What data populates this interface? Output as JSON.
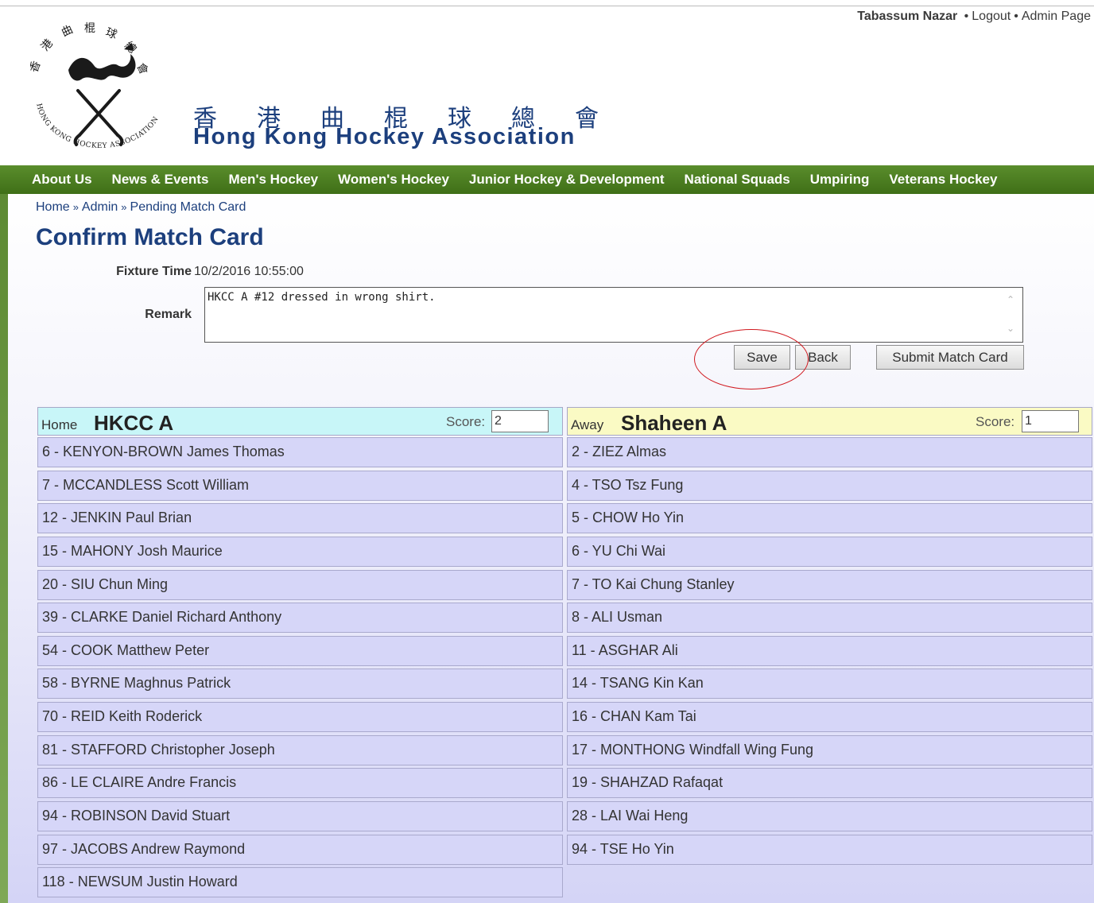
{
  "user_bar": {
    "user_name": "Tabassum Nazar",
    "separator": "•",
    "logout": "Logout",
    "admin_page": "Admin Page"
  },
  "header": {
    "title_cn": [
      "香",
      "港",
      "曲",
      "棍",
      "球",
      "總",
      "會"
    ],
    "title_en": "Hong Kong Hockey Association"
  },
  "nav": {
    "items": [
      "About Us",
      "News & Events",
      "Men's Hockey",
      "Women's Hockey",
      "Junior Hockey & Development",
      "National Squads",
      "Umpiring",
      "Veterans Hockey"
    ]
  },
  "breadcrumb": {
    "items": [
      "Home",
      "Admin",
      "Pending Match Card"
    ],
    "separator": "»"
  },
  "page_title": "Confirm Match Card",
  "form": {
    "fixture_time_label": "Fixture Time",
    "fixture_time_value": "10/2/2016 10:55:00",
    "remark_label": "Remark",
    "remark_value": "HKCC A #12 dressed in wrong shirt."
  },
  "buttons": {
    "save": "Save",
    "back": "Back",
    "submit": "Submit Match Card"
  },
  "home": {
    "side_label": "Home",
    "team_name": "HKCC A",
    "score_label": "Score:",
    "score": "2",
    "players": [
      "6 - KENYON-BROWN James Thomas",
      "7 - MCCANDLESS Scott William",
      "12 - JENKIN Paul Brian",
      "15 - MAHONY Josh Maurice",
      "20 - SIU Chun Ming",
      "39 - CLARKE Daniel Richard Anthony",
      "54 - COOK Matthew Peter",
      "58 - BYRNE Maghnus Patrick",
      "70 - REID Keith Roderick",
      "81 - STAFFORD Christopher Joseph",
      "86 - LE CLAIRE Andre Francis",
      "94 - ROBINSON David Stuart",
      "97 - JACOBS Andrew Raymond",
      "118 - NEWSUM Justin Howard"
    ]
  },
  "away": {
    "side_label": "Away",
    "team_name": "Shaheen A",
    "score_label": "Score:",
    "score": "1",
    "players": [
      "2 - ZIEZ Almas",
      "4 - TSO Tsz Fung",
      "5 - CHOW Ho Yin",
      "6 - YU Chi Wai",
      "7 - TO Kai Chung Stanley",
      "8 - ALI Usman",
      "11 - ASGHAR Ali",
      "14 - TSANG Kin Kan",
      "16 - CHAN Kam Tai",
      "17 - MONTHONG Windfall Wing Fung",
      "19 - SHAHZAD Rafaqat",
      "28 - LAI Wai Heng",
      "94 - TSE Ho Yin"
    ]
  },
  "colors": {
    "brand_blue": "#1c3f7d",
    "nav_green": "#4a7d22",
    "home_header": "#c8f6f8",
    "away_header": "#fafac4",
    "row_bg": "#d6d6f8",
    "annotation_red": "#d0181e"
  },
  "icons": {
    "scroll_up": "chevron-up-icon",
    "scroll_down": "chevron-down-icon",
    "logo": "hkha-crest-logo"
  }
}
